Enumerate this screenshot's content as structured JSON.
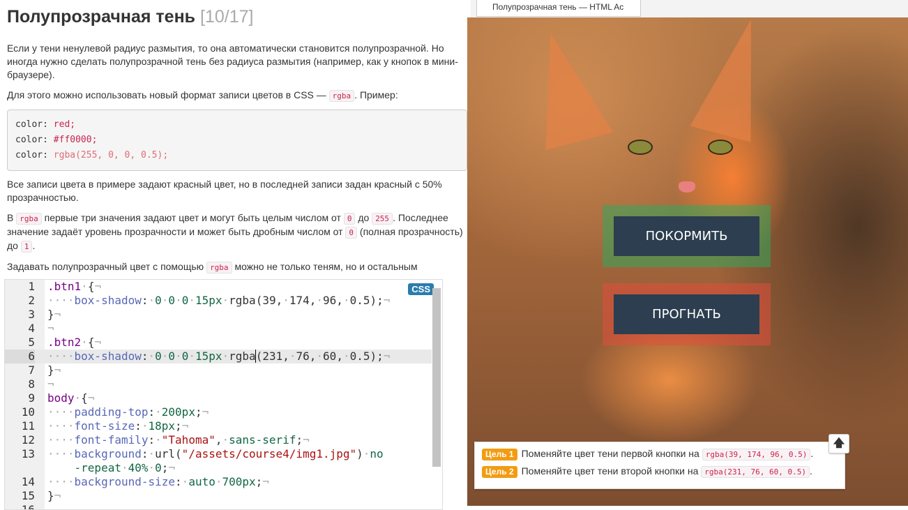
{
  "theory": {
    "title": "Полупрозрачная тень",
    "counter": "[10/17]",
    "p1": "Если у тени ненулевой радиус размытия, то она автоматически становится полупрозрачной. Но иногда нужно сделать полупрозрачной тень без радиуса размытия (например, как у кнопок в мини-браузере).",
    "p2_before": "Для этого можно использовать новый формат записи цветов в CSS — ",
    "p2_code": "rgba",
    "p2_after": ". Пример:",
    "example": [
      {
        "prop": "color: ",
        "value": "red;"
      },
      {
        "prop": "color: ",
        "value": "#ff0000;"
      },
      {
        "prop": "color: ",
        "value": "rgba(255, 0, 0, 0.5);"
      }
    ],
    "p3": "Все записи цвета в примере задают красный цвет, но в последней записи задан красный с 50% прозрачностью.",
    "p4": {
      "t1": "В ",
      "c1": "rgba",
      "t2": " первые три значения задают цвет и могут быть целым числом от ",
      "c2": "0",
      "t3": " до ",
      "c3": "255",
      "t4": ". Последнее значение задаёт уровень прозрачности и может быть дробным числом от ",
      "c4": "0",
      "t5": " (полная прозрачность) до ",
      "c5": "1",
      "t6": "."
    },
    "p5": {
      "t1": "Задавать полупрозрачный цвет с помощью ",
      "c1": "rgba",
      "t2": " можно не только теням, но и остальным свойствам с цветом: рамкам, фону и т.д."
    }
  },
  "editor": {
    "language": "CSS",
    "active_line": 6,
    "line_numbers": [
      "1",
      "2",
      "3",
      "4",
      "5",
      "6",
      "7",
      "8",
      "9",
      "10",
      "11",
      "12",
      "13",
      "",
      "14",
      "15",
      "16"
    ]
  },
  "preview": {
    "tab_title": "Полупрозрачная тень — HTML Ac",
    "button1_label": "ПОКОРМИТЬ",
    "button2_label": "ПРОГНАТЬ",
    "button1_shadow": "#27ae60",
    "button2_shadow": "#e74c3c"
  },
  "goals": [
    {
      "badge": "Цель 1",
      "text": "Поменяйте цвет тени первой кнопки на ",
      "code": "rgba(39, 174, 96, 0.5)",
      "end": "."
    },
    {
      "badge": "Цель 2",
      "text": "Поменяйте цвет тени второй кнопки на ",
      "code": "rgba(231, 76, 60, 0.5)",
      "end": "."
    }
  ],
  "up_button_icon": "arrow-up-icon"
}
